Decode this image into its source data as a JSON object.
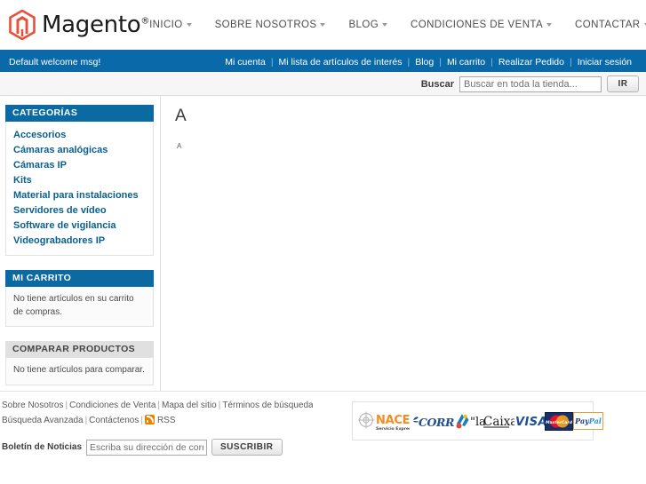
{
  "header": {
    "logo_text": "Magento",
    "logo_sup": "®",
    "logo_icon": "magento-hexagon-logo",
    "nav": [
      {
        "label": "INICIO",
        "has_caret": true
      },
      {
        "label": "SOBRE NOSOTROS",
        "has_caret": true
      },
      {
        "label": "BLOG",
        "has_caret": true
      },
      {
        "label": "CONDICIONES DE VENTA",
        "has_caret": true
      },
      {
        "label": "CONTACTAR",
        "has_caret": true
      }
    ]
  },
  "welcome_bar": {
    "message": "Default welcome msg!",
    "links": [
      "Mi cuenta",
      "Mi lista de artículos de interés",
      "Blog",
      "Mi carrito",
      "Realizar Pedido",
      "Iniciar sesión"
    ],
    "separator": "|",
    "background_color": "#0a69a8"
  },
  "search": {
    "label": "Buscar",
    "placeholder": "Buscar en toda la tienda...",
    "value": "",
    "button_label": "IR"
  },
  "sidebar": {
    "categories": {
      "title": "CATEGORÍAS",
      "items": [
        "Accesorios",
        "Cámaras analógicas",
        "Cámaras IP",
        "Kits",
        "Material para instalaciones",
        "Servidores de vídeo",
        "Software de vigilancia",
        "Videograbadores IP"
      ]
    },
    "cart": {
      "title": "MI CARRITO",
      "empty_text": "No tiene artículos en su carrito de compras."
    },
    "compare": {
      "title": "COMPARAR PRODUCTOS",
      "empty_text": "No tiene artículos para comparar."
    }
  },
  "content": {
    "heading": "A",
    "subtext": "A"
  },
  "footer": {
    "links_row1": [
      "Sobre Nosotros",
      "Condiciones de Venta",
      "Mapa del sitio",
      "Términos de búsqueda"
    ],
    "links_row2": [
      "Búsqueda Avanzada",
      "Contáctenos"
    ],
    "rss_label": "RSS",
    "rss_icon": "rss-feed-icon",
    "newsletter": {
      "label": "Boletín de Noticias",
      "placeholder": "Escriba su dirección de correo electrónico",
      "value": "",
      "button_label": "SUSCRIBIR"
    },
    "payment_logos": [
      {
        "name": "NACEX",
        "sub": "Servicio Express"
      },
      {
        "name": "CORREOS",
        "sub": ""
      },
      {
        "name": "\"la Caixa\"",
        "sub": ""
      },
      {
        "name": "VISA",
        "sub": ""
      },
      {
        "name": "MasterCard",
        "sub": ""
      },
      {
        "name": "PayPal",
        "sub": ""
      }
    ]
  },
  "colors": {
    "accent_blue": "#0a69a8",
    "link_blue": "#0a5f91",
    "magento_red": "#ee5533",
    "rss_orange": "#f08000"
  }
}
